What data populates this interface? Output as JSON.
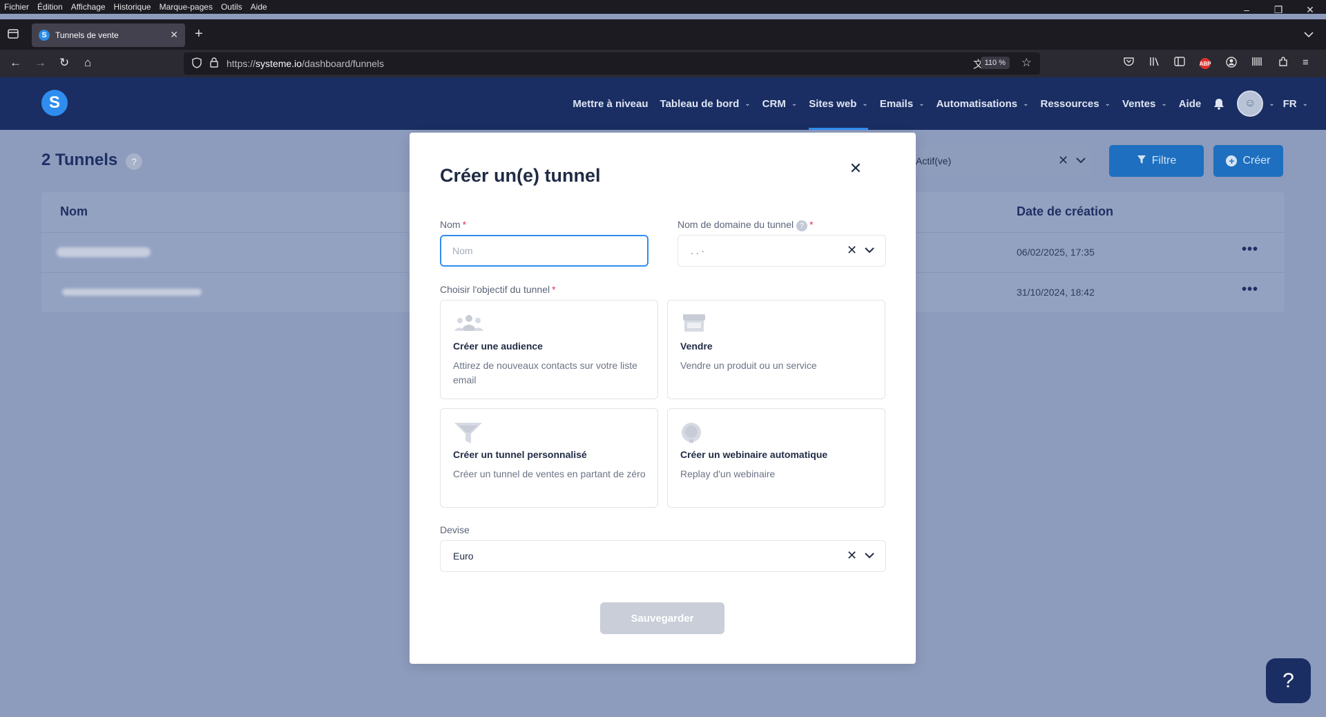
{
  "menubar": [
    "Fichier",
    "Édition",
    "Affichage",
    "Historique",
    "Marque-pages",
    "Outils",
    "Aide"
  ],
  "window_controls": [
    "–",
    "❐",
    "✕"
  ],
  "tab": {
    "title": "Tunnels de vente",
    "favicon": "S"
  },
  "url": {
    "prefix": "https://",
    "host": "systeme.io",
    "path": "/dashboard/funnels"
  },
  "zoom": "110 %",
  "toolbar_icons": [
    "pocket-icon",
    "library-icon",
    "sidebar-icon",
    "adblock-icon",
    "account-icon",
    "extensions-icon",
    "puzzle-icon",
    "menu-icon"
  ],
  "abp_label": "ABP",
  "app": {
    "logo_letter": "S",
    "nav": [
      {
        "label": "Mettre à niveau",
        "chevron": false
      },
      {
        "label": "Tableau de bord",
        "chevron": true
      },
      {
        "label": "CRM",
        "chevron": true
      },
      {
        "label": "Sites web",
        "chevron": true,
        "active": true
      },
      {
        "label": "Emails",
        "chevron": true
      },
      {
        "label": "Automatisations",
        "chevron": true
      },
      {
        "label": "Ressources",
        "chevron": true
      },
      {
        "label": "Ventes",
        "chevron": true
      },
      {
        "label": "Aide",
        "chevron": false
      }
    ],
    "language": "FR"
  },
  "page": {
    "title": "2 Tunnels",
    "status_filter": "Actif(ve)",
    "filter_button": "Filtre",
    "create_button": "Créer",
    "columns": {
      "name": "Nom",
      "created": "Date de création"
    },
    "rows": [
      {
        "date": "06/02/2025, 17:35"
      },
      {
        "date": "31/10/2024, 18:42"
      }
    ]
  },
  "modal": {
    "title": "Créer un(e) tunnel",
    "name_label": "Nom",
    "name_placeholder": "Nom",
    "domain_label": "Nom de domaine du tunnel",
    "domain_value": ".              .           ·",
    "goal_label": "Choisir l'objectif du tunnel",
    "goals": [
      {
        "title": "Créer une audience",
        "description": "Attirez de nouveaux contacts sur votre liste email",
        "icon": "audience-icon"
      },
      {
        "title": "Vendre",
        "description": "Vendre un produit ou un service",
        "icon": "store-icon"
      },
      {
        "title": "Créer un tunnel personnalisé",
        "description": "Créer un tunnel de ventes en partant de zéro",
        "icon": "funnel-icon"
      },
      {
        "title": "Créer un webinaire automatique",
        "description": "Replay d'un webinaire",
        "icon": "webinar-icon"
      }
    ],
    "currency_label": "Devise",
    "currency_value": "Euro",
    "save_button": "Sauvegarder",
    "required_mark": "*"
  },
  "help_fab": "?",
  "colors": {
    "header": "#1a2e63",
    "accent": "#2f8df0",
    "overlay_bg": "#8d9bbd",
    "required": "#e0334f"
  }
}
